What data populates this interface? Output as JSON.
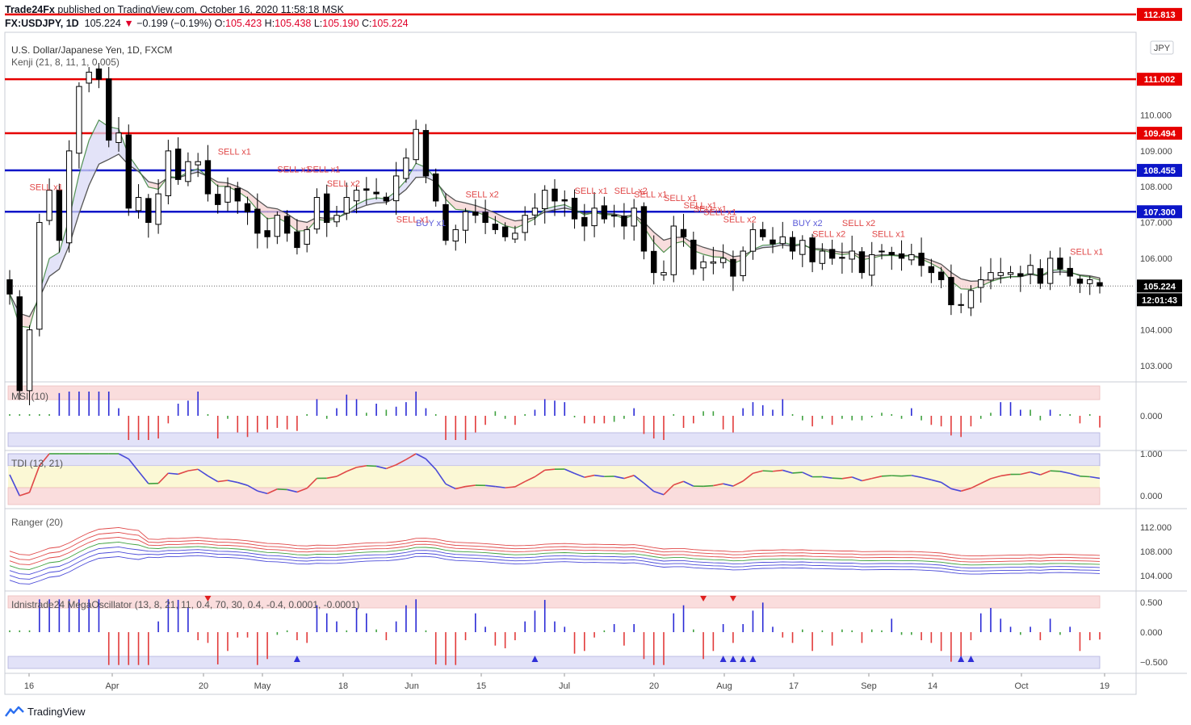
{
  "header": {
    "publisher": "Trade24Fx",
    "published_text": " published on TradingView.com, October 16, 2020 11:58:18 MSK",
    "symbol": "FX:USDJPY, 1D",
    "last": "105.224",
    "arrow": "▼",
    "change": "−0.199 (−0.19%)",
    "o_label": "O:",
    "o_value": "105.423",
    "h_label": "H:",
    "h_value": "105.438",
    "l_label": "L:",
    "l_value": "105.190",
    "c_label": "C:",
    "c_value": "105.224"
  },
  "main_pane": {
    "title": "U.S. Dollar/Japanese Yen, 1D, FXCM",
    "indicator": "Kenji (21, 8, 11, 1, 0.005)",
    "currency_badge": "JPY",
    "price_ticks": [
      "110.000",
      "109.000",
      "108.000",
      "107.000",
      "106.000",
      "104.000",
      "103.000"
    ],
    "level_labels": [
      "112.813",
      "111.002",
      "109.494",
      "108.455",
      "107.300"
    ],
    "current_price_label": "105.224",
    "countdown_label": "12:01:43",
    "signals": [
      "SELL x1",
      "SELL x1",
      "SELL x1",
      "SELL x1",
      "SELL x2",
      "BUY x1",
      "SELL x1",
      "SELL x2",
      "SELL x1",
      "SELL x2",
      "SELL x1",
      "SELL x1",
      "SELL x1",
      "SELL x1",
      "SELL x1",
      "SELL x2",
      "BUY x2",
      "SELL x2",
      "SELL x1",
      "SELL x2",
      "SELL x1"
    ]
  },
  "msi_pane": {
    "title": "MSI (10)",
    "ticks": [
      "0.000"
    ]
  },
  "tdi_pane": {
    "title": "TDI (13, 21)",
    "ticks": [
      "1.000",
      "0.000"
    ]
  },
  "ranger_pane": {
    "title": "Ranger (20)",
    "ticks": [
      "112.000",
      "108.000",
      "104.000"
    ]
  },
  "mega_pane": {
    "title": "Idnistrade24 MegaOscillator (13, 8, 21, 11, 0.4, 70, 30, 0.4, -0.4, 0.0001, -0.0001)",
    "ticks": [
      "0.500",
      "0.000",
      "−0.500"
    ]
  },
  "time_axis": {
    "labels": [
      "16",
      "Apr",
      "20",
      "May",
      "18",
      "Jun",
      "15",
      "Jul",
      "20",
      "Aug",
      "17",
      "Sep",
      "14",
      "Oct",
      "19"
    ]
  },
  "footer": {
    "brand": "TradingView"
  },
  "colors": {
    "red_level": "#e60000",
    "blue_level": "#0b15c8",
    "up_blue": "#2a2ad6",
    "down_red": "#e23a3a",
    "neutral_green": "#3fa13f"
  },
  "chart_data": {
    "type": "candlestick",
    "title": "U.S. Dollar/Japanese Yen, 1D, FXCM",
    "ylim": [
      102.6,
      113.3
    ],
    "horizontal_levels": [
      {
        "value": 112.813,
        "color": "red"
      },
      {
        "value": 111.002,
        "color": "red"
      },
      {
        "value": 109.494,
        "color": "red"
      },
      {
        "value": 108.455,
        "color": "blue"
      },
      {
        "value": 107.3,
        "color": "blue"
      }
    ],
    "last_price": 105.224,
    "closes": [
      105.0,
      102.3,
      104.0,
      107.0,
      107.9,
      106.5,
      109.0,
      110.8,
      111.2,
      111.0,
      109.3,
      109.5,
      107.4,
      107.7,
      107.0,
      107.8,
      109.0,
      108.2,
      108.7,
      108.7,
      107.8,
      107.5,
      108.0,
      107.6,
      107.3,
      106.7,
      106.6,
      107.2,
      106.7,
      106.3,
      106.8,
      107.7,
      107.0,
      107.2,
      107.7,
      107.9,
      107.9,
      107.8,
      107.6,
      108.3,
      108.8,
      109.6,
      108.3,
      107.6,
      106.5,
      106.8,
      107.3,
      107.2,
      107.0,
      106.8,
      106.6,
      106.7,
      107.2,
      107.4,
      107.9,
      107.6,
      107.6,
      107.1,
      106.9,
      107.4,
      107.1,
      107.2,
      106.9,
      107.4,
      106.2,
      105.6,
      105.6,
      106.9,
      106.6,
      105.7,
      105.9,
      105.9,
      106.0,
      105.5,
      106.2,
      106.8,
      106.6,
      106.4,
      106.6,
      106.2,
      106.5,
      105.9,
      106.2,
      106.0,
      106.0,
      106.2,
      105.6,
      106.1,
      106.2,
      106.1,
      106.0,
      106.1,
      105.8,
      105.6,
      105.4,
      104.7,
      104.7,
      105.1,
      105.4,
      105.6,
      105.6,
      105.6,
      105.5,
      105.8,
      105.3,
      106.0,
      105.7,
      105.5,
      105.3,
      105.4,
      105.224
    ]
  }
}
